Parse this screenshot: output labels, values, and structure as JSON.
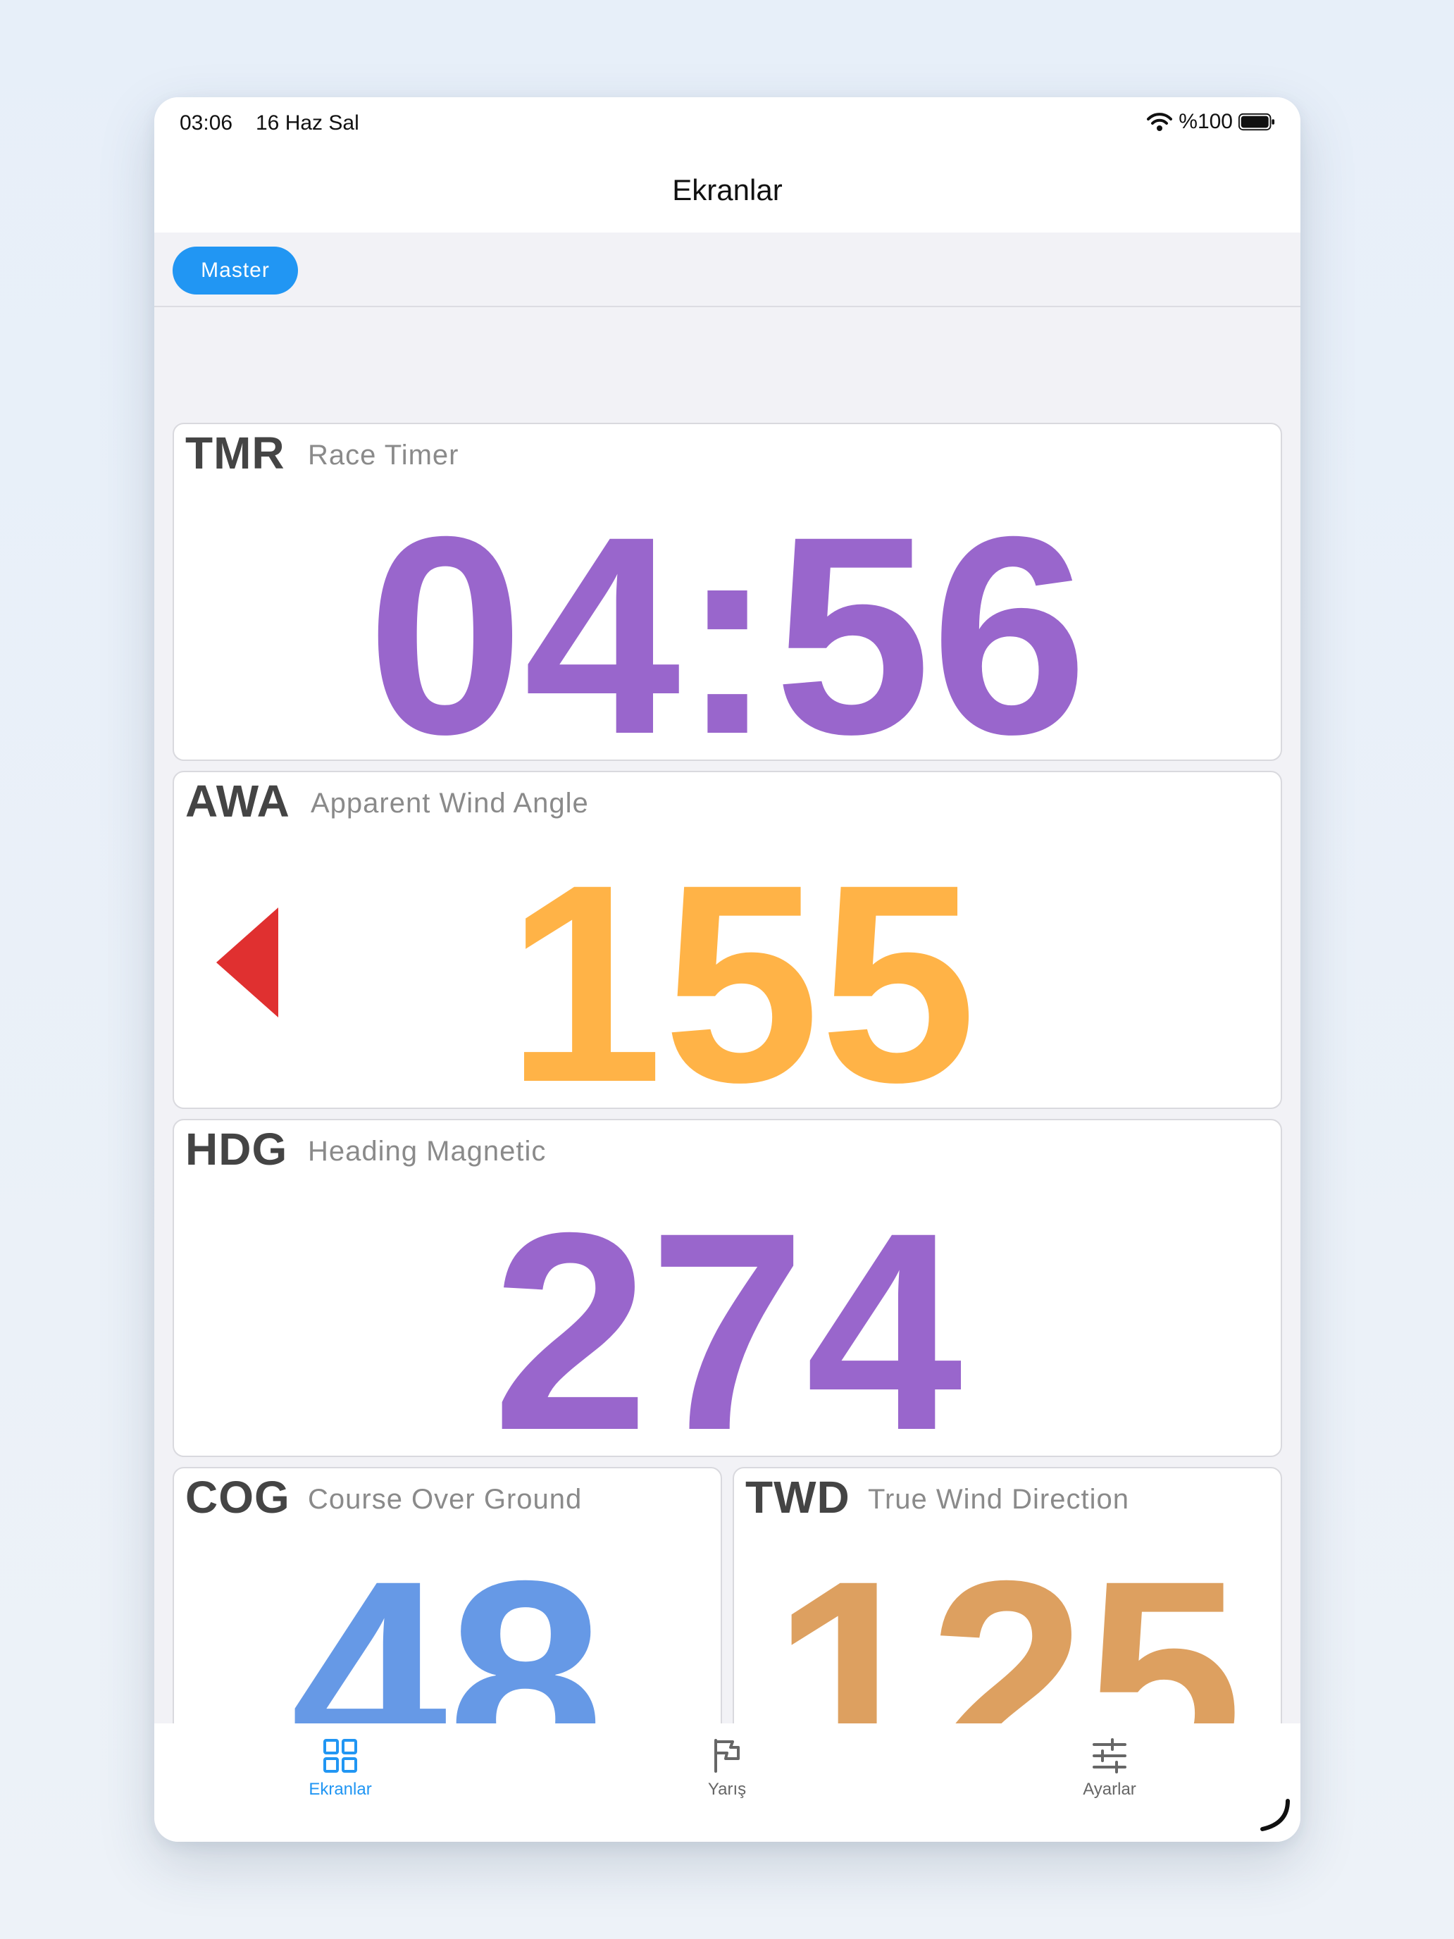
{
  "status": {
    "time": "03:06",
    "date": "16 Haz Sal",
    "battery": "%100"
  },
  "header": {
    "title": "Ekranlar"
  },
  "subbar": {
    "master_label": "Master"
  },
  "panels": {
    "tmr": {
      "code": "TMR",
      "name": "Race Timer",
      "value": "04:56",
      "color": "#9966cc"
    },
    "awa": {
      "code": "AWA",
      "name": "Apparent Wind Angle",
      "value": "155",
      "color": "#ffb347",
      "arrow_color": "#e03030"
    },
    "hdg": {
      "code": "HDG",
      "name": "Heading Magnetic",
      "value": "274",
      "color": "#9966cc"
    },
    "cog": {
      "code": "COG",
      "name": "Course Over Ground",
      "value": "48",
      "color": "#6699e6"
    },
    "twd": {
      "code": "TWD",
      "name": "True Wind Direction",
      "value": "125",
      "color": "#dda060"
    }
  },
  "tabs": [
    {
      "label": "Ekranlar",
      "icon": "grid-icon",
      "active": true
    },
    {
      "label": "Yarış",
      "icon": "flag-icon",
      "active": false
    },
    {
      "label": "Ayarlar",
      "icon": "sliders-icon",
      "active": false
    }
  ],
  "colors": {
    "accent": "#2196f3",
    "inactive": "#666666"
  }
}
